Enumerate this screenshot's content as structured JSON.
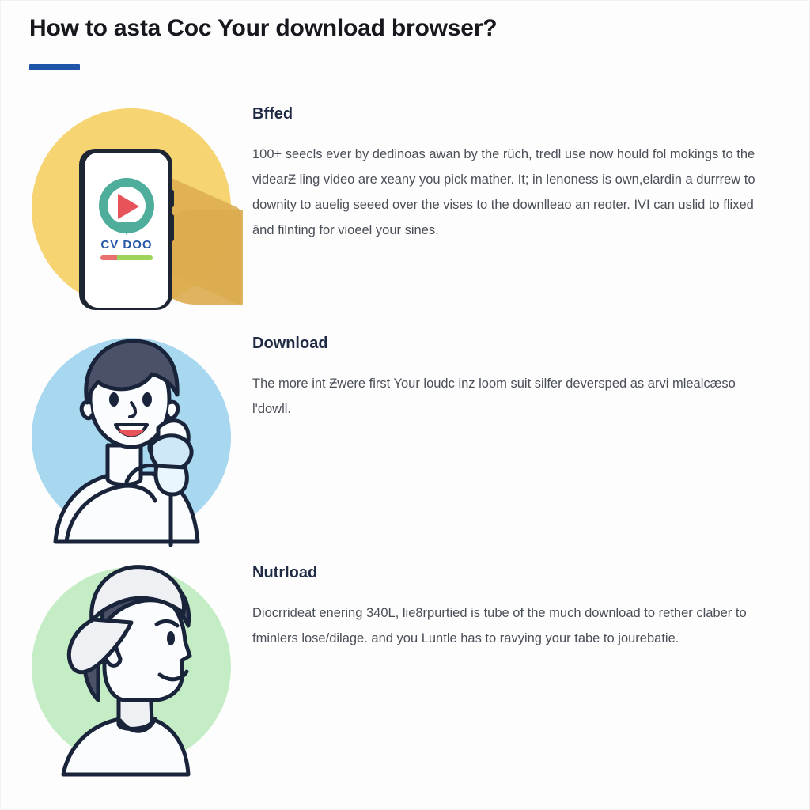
{
  "page": {
    "title": "How to asta Coc Your download browser?",
    "accent_color": "#1f55a8",
    "background": "#fdfdfe"
  },
  "sections": [
    {
      "id": "bffed",
      "heading": "Bffed",
      "text": "100+ seecls ever by dedinoas awan by the rüch, tredl use now hould fol mokings to the videarƵ ling video are xeany you pick mather. It; in lenoness is own,elardin a durrrew to downity to auelig seeed over the vises to the downlleao an reoter. IVI can uslid to flixed ānd filnting for vioeel your sines.",
      "illustration": {
        "name": "phone-app-illustration",
        "circle_color": "#f5d471",
        "shadow_color": "#dcab4e",
        "logo_text": "CV DOO",
        "logo_ring_color": "#4fae9b",
        "logo_play_color": "#e8535a",
        "logo_text_color": "#2557a7",
        "progress_colors": [
          "#e8716f",
          "#9ed45b"
        ],
        "phone_frame_color": "#1f2633",
        "phone_screen_color": "#ffffff"
      }
    },
    {
      "id": "download",
      "heading": "Download",
      "text": "The more int Ƶwere first Your loudc inz loom suit silfer deversped as arvi mlealcæso l'dowll.",
      "illustration": {
        "name": "person-holding-device-illustration",
        "circle_color": "#a8d8ef",
        "hair_color": "#4a5168",
        "skin_color": "#fbfcfe",
        "outline_color": "#19243a",
        "device_color": "#cfe8f7",
        "mouth_color": "#e8535a"
      }
    },
    {
      "id": "nutrload",
      "heading": "Nutrload",
      "text": "Diocrrideat enering 340L, lie8rpurtied is tube of the much download to rether claber to fminlers lose/dilage. and you Luntle has to ravying your tabe to jourebatie.",
      "illustration": {
        "name": "person-profile-cap-illustration",
        "circle_color": "#c5edc5",
        "hair_color": "#4a5168",
        "cap_color": "#eef0f3",
        "skin_color": "#fbfcfe",
        "outline_color": "#19243a"
      }
    }
  ]
}
